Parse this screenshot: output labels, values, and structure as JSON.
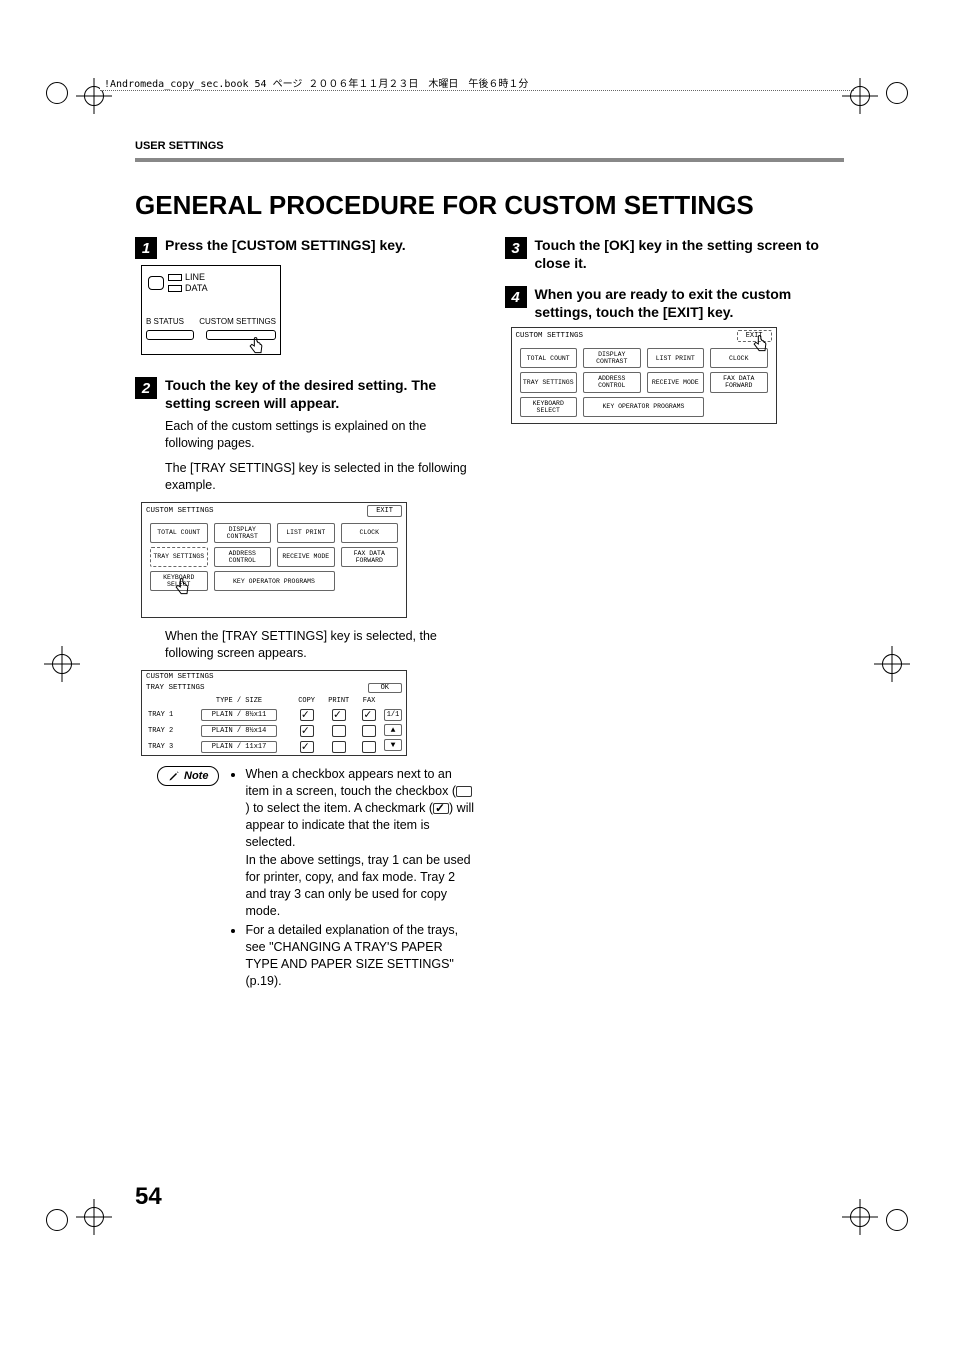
{
  "meta": {
    "header_text": "!Andromeda_copy_sec.book  54 ページ  ２００６年１１月２３日　木曜日　午後６時１分"
  },
  "section_label": "USER SETTINGS",
  "title": "GENERAL PROCEDURE FOR CUSTOM SETTINGS",
  "page_number": "54",
  "steps": {
    "s1": {
      "num": "1",
      "title": "Press the [CUSTOM SETTINGS] key."
    },
    "s2": {
      "num": "2",
      "title": "Touch the key of the desired setting. The setting screen will appear.",
      "body1": "Each of the custom settings is explained on the following pages.",
      "body2": "The [TRAY SETTINGS] key is selected in the following example.",
      "after_screen": "When the [TRAY SETTINGS] key is selected, the following screen appears."
    },
    "s3": {
      "num": "3",
      "title": "Touch the [OK] key in the setting screen to close it."
    },
    "s4": {
      "num": "4",
      "title": "When you are ready to exit the custom settings, touch the [EXIT] key."
    }
  },
  "panel": {
    "line": "LINE",
    "data": "DATA",
    "status": "B STATUS",
    "custom": "CUSTOM SETTINGS"
  },
  "lcd_menu": {
    "header": "CUSTOM SETTINGS",
    "exit": "EXIT",
    "items": {
      "total_count": "TOTAL COUNT",
      "display_contrast": "DISPLAY CONTRAST",
      "list_print": "LIST PRINT",
      "clock": "CLOCK",
      "tray_settings": "TRAY SETTINGS",
      "address_control": "ADDRESS CONTROL",
      "receive_mode": "RECEIVE MODE",
      "fax_data_forward": "FAX DATA FORWARD",
      "keyboard_select": "KEYBOARD SELECT",
      "key_op": "KEY OPERATOR PROGRAMS"
    }
  },
  "lcd_tray": {
    "header": "CUSTOM SETTINGS",
    "sub": "TRAY SETTINGS",
    "ok": "OK",
    "cols": {
      "typesize": "TYPE / SIZE",
      "copy": "COPY",
      "print": "PRINT",
      "fax": "FAX"
    },
    "page": "1/1",
    "rows": [
      {
        "name": "TRAY 1",
        "typesize": "PLAIN / 8½x11",
        "copy": true,
        "print": true,
        "fax": true
      },
      {
        "name": "TRAY 2",
        "typesize": "PLAIN / 8½x14",
        "copy": true,
        "print": false,
        "fax": false
      },
      {
        "name": "TRAY 3",
        "typesize": "PLAIN / 11x17",
        "copy": true,
        "print": false,
        "fax": false
      }
    ]
  },
  "note": {
    "label": "Note",
    "b1a": "When a checkbox appears next to an item in a screen, touch the checkbox (",
    "b1b": ") to select the item. A checkmark (",
    "b1c": ") will appear to indicate that the item is selected.",
    "b1d": "In the above settings, tray 1 can be used for printer, copy, and fax mode. Tray 2 and tray 3 can only be used for copy mode.",
    "b2": "For a detailed explanation of the trays, see \"CHANGING A TRAY'S PAPER TYPE AND PAPER SIZE SETTINGS\" (p.19)."
  }
}
